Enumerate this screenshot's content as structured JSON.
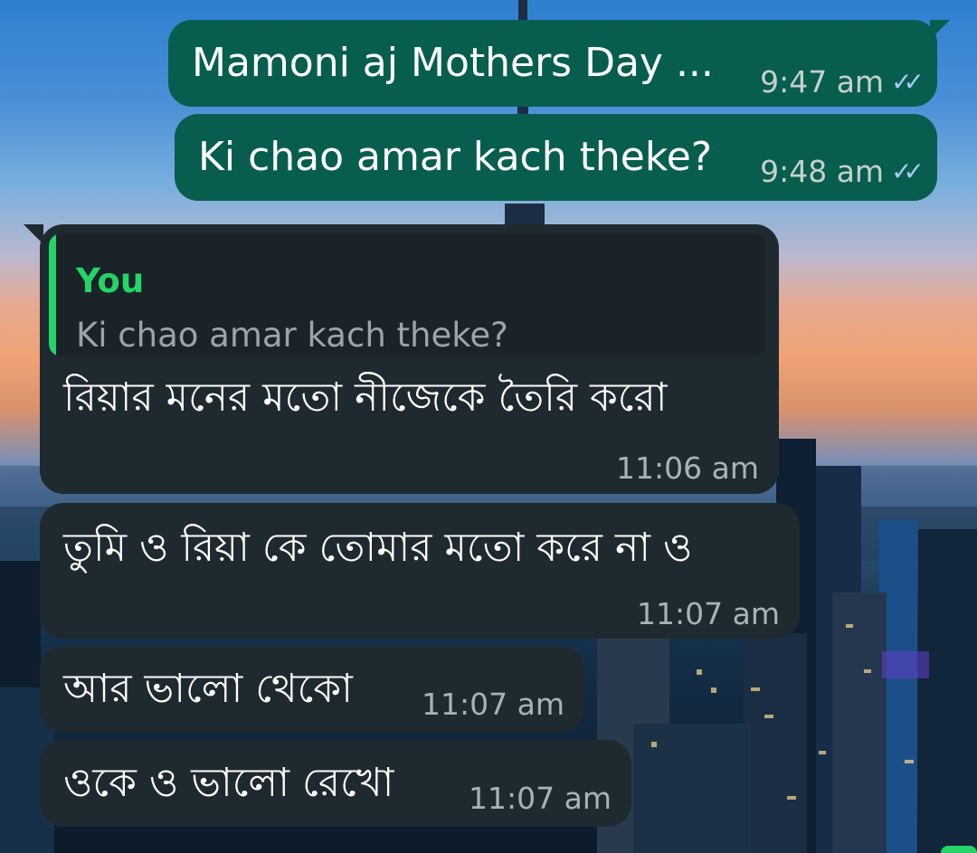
{
  "chat": {
    "messages": [
      {
        "id": "m1",
        "direction": "outgoing",
        "text": "Mamoni aj Mothers Day ...",
        "time": "9:47 am",
        "status": "read"
      },
      {
        "id": "m2",
        "direction": "outgoing",
        "text": "Ki chao amar kach theke?",
        "time": "9:48 am",
        "status": "read"
      },
      {
        "id": "m3",
        "direction": "incoming",
        "reply": {
          "sender": "You",
          "text": "Ki chao amar kach theke?"
        },
        "text": "রিয়ার মনের মতো নীজেকে তৈরি করো",
        "time": "11:06 am"
      },
      {
        "id": "m4",
        "direction": "incoming",
        "text": "তুমি ও রিয়া কে তোমার মতো করে না ও",
        "time": "11:07 am"
      },
      {
        "id": "m5",
        "direction": "incoming",
        "text": "আর ভালো থেকো",
        "time": "11:07 am"
      },
      {
        "id": "m6",
        "direction": "incoming",
        "text": "ওকে ও ভালো রেখো",
        "time": "11:07 am"
      }
    ]
  },
  "icons": {
    "read_receipt": "double-check-icon"
  },
  "colors": {
    "outgoing_bubble": "#075e4e",
    "incoming_bubble": "#1f2a30",
    "reply_accent": "#25d366",
    "read_tick": "#a9c9f5"
  }
}
